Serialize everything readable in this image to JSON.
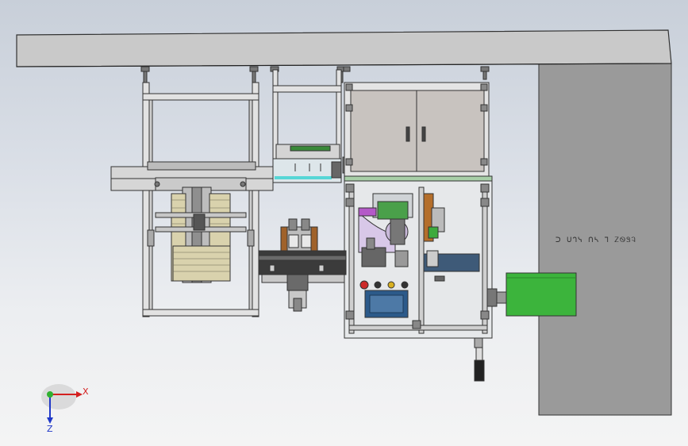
{
  "wall_text": "ᑐ ᑌᒉᓭ ᑎᓴ ᒣ ᏃᏫᏕᎸ",
  "triad": {
    "x_label": "X",
    "z_label": "Z"
  },
  "colors": {
    "beam": "#c9c9c9",
    "wall": "#9a9a9a",
    "motor": "#3cb43c",
    "frame": "#e2e2e2",
    "cabinet": "#c8c3bf",
    "dark": "#3a3a3a",
    "screen": "#2c5a8a"
  }
}
